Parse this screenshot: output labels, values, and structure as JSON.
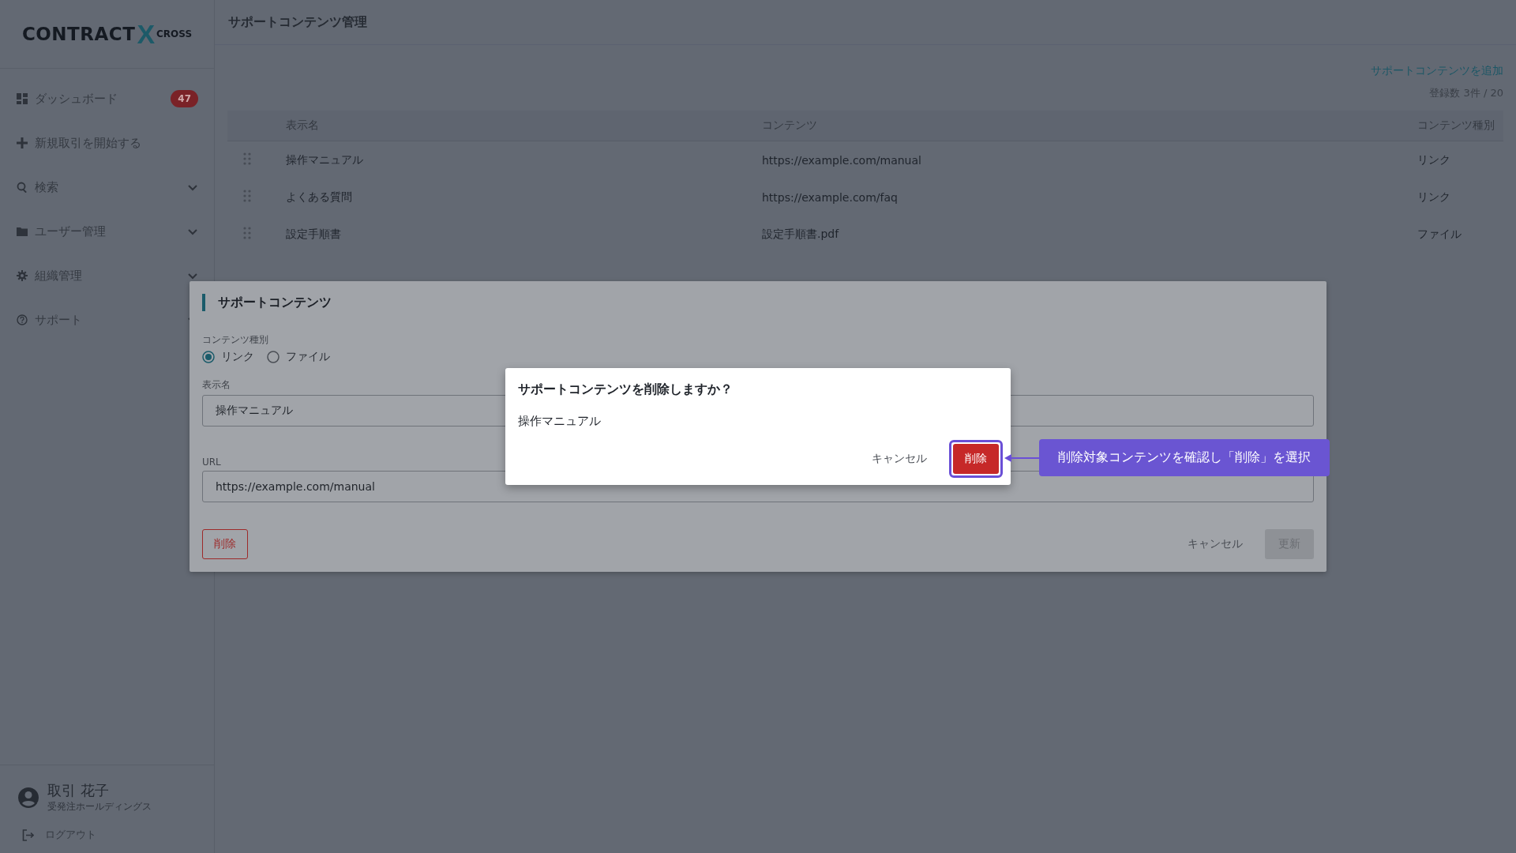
{
  "logo": {
    "word": "CONTRACT",
    "mark": "X",
    "suffix": "CROSS"
  },
  "sidebar": {
    "items": [
      {
        "kind": "link",
        "label": "ダッシュボード",
        "badge": "47"
      },
      {
        "kind": "link",
        "label": "新規取引を開始する"
      },
      {
        "kind": "group",
        "label": "検索",
        "expanded": false
      },
      {
        "kind": "group",
        "label": "ユーザー管理",
        "expanded": false
      },
      {
        "kind": "group",
        "label": "組織管理",
        "expanded": false
      },
      {
        "kind": "group",
        "label": "サポート",
        "expanded": false
      }
    ],
    "user": {
      "name": "取引 花子",
      "company": "受発注ホールディングス"
    },
    "logout": "ログアウト"
  },
  "page": {
    "title": "サポートコンテンツ管理",
    "add_link": "サポートコンテンツを追加",
    "count": "登録数 3件 / 20"
  },
  "table": {
    "columns": [
      "表示名",
      "コンテンツ",
      "コンテンツ種別"
    ],
    "rows": [
      {
        "cells": [
          "操作マニュアル",
          "https://example.com/manual",
          "リンク"
        ]
      },
      {
        "cells": [
          "よくある質問",
          "https://example.com/faq",
          "リンク"
        ]
      },
      {
        "cells": [
          "設定手順書",
          "設定手順書.pdf",
          "ファイル"
        ]
      }
    ]
  },
  "form_dialog": {
    "title": "サポートコンテンツ",
    "type_label": "コンテンツ種別",
    "type_options": [
      {
        "label": "リンク",
        "selected": true
      },
      {
        "label": "ファイル",
        "selected": false
      }
    ],
    "fields": [
      {
        "label": "表示名",
        "value": "操作マニュアル"
      },
      {
        "label": "URL",
        "value": "https://example.com/manual"
      }
    ],
    "delete_button": "削除",
    "cancel_button": "キャンセル",
    "update_button": {
      "label": "更新",
      "disabled": true
    }
  },
  "confirm_dialog": {
    "title": "サポートコンテンツを削除しますか？",
    "message": "操作マニュアル",
    "cancel_button": "キャンセル",
    "delete_button": {
      "label": "削除",
      "highlighted": true
    }
  },
  "callout": {
    "text": "削除対象コンテンツを確認し「削除」を選択"
  }
}
